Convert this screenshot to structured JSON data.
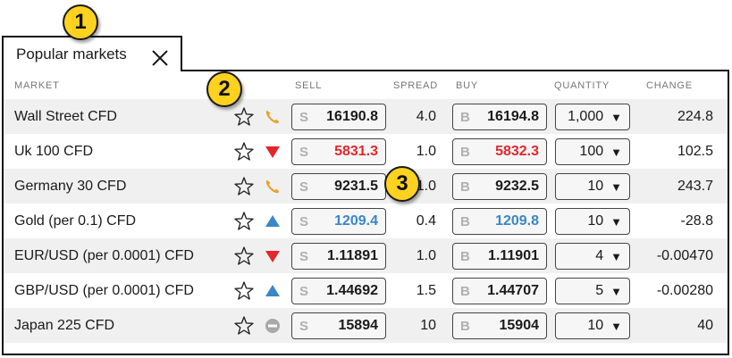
{
  "tab": {
    "title": "Popular markets"
  },
  "badges": [
    "1",
    "2",
    "3"
  ],
  "headers": {
    "market": "MARKET",
    "sell": "SELL",
    "spread": "SPREAD",
    "buy": "BUY",
    "quantity": "QUANTITY",
    "change": "CHANGE"
  },
  "colors": {
    "up": "#3a86c8",
    "down": "#e3262b",
    "neutral": "#1a1a1a",
    "phone": "#e8a22c",
    "closed": "#a8a8a8"
  },
  "rows": [
    {
      "market": "Wall Street CFD",
      "indicator": "phone-icon",
      "sell_letter": "S",
      "sell": "16190.8",
      "spread": "4.0",
      "buy_letter": "B",
      "buy": "16194.8",
      "price_color": "neutral",
      "qty": "1,000",
      "change": "224.8"
    },
    {
      "market": "Uk 100 CFD",
      "indicator": "down-arrow-icon",
      "sell_letter": "S",
      "sell": "5831.3",
      "spread": "1.0",
      "buy_letter": "B",
      "buy": "5832.3",
      "price_color": "down",
      "qty": "100",
      "change": "102.5"
    },
    {
      "market": "Germany 30 CFD",
      "indicator": "phone-icon",
      "sell_letter": "S",
      "sell": "9231.5",
      "spread": "1.0",
      "buy_letter": "B",
      "buy": "9232.5",
      "price_color": "neutral",
      "qty": "10",
      "change": "243.7"
    },
    {
      "market": "Gold (per 0.1) CFD",
      "indicator": "up-arrow-icon",
      "sell_letter": "S",
      "sell": "1209.4",
      "spread": "0.4",
      "buy_letter": "B",
      "buy": "1209.8",
      "price_color": "up",
      "qty": "10",
      "change": "-28.8"
    },
    {
      "market": "EUR/USD (per 0.0001) CFD",
      "indicator": "down-arrow-icon",
      "sell_letter": "S",
      "sell": "1.11891",
      "spread": "1.0",
      "buy_letter": "B",
      "buy": "1.11901",
      "price_color": "neutral",
      "qty": "4",
      "change": "-0.00470"
    },
    {
      "market": "GBP/USD (per 0.0001) CFD",
      "indicator": "up-arrow-icon",
      "sell_letter": "S",
      "sell": "1.44692",
      "spread": "1.5",
      "buy_letter": "B",
      "buy": "1.44707",
      "price_color": "neutral",
      "qty": "5",
      "change": "-0.00280"
    },
    {
      "market": "Japan 225 CFD",
      "indicator": "market-closed-icon",
      "sell_letter": "S",
      "sell": "15894",
      "spread": "10",
      "buy_letter": "B",
      "buy": "15904",
      "price_color": "neutral",
      "qty": "10",
      "change": "40"
    }
  ]
}
